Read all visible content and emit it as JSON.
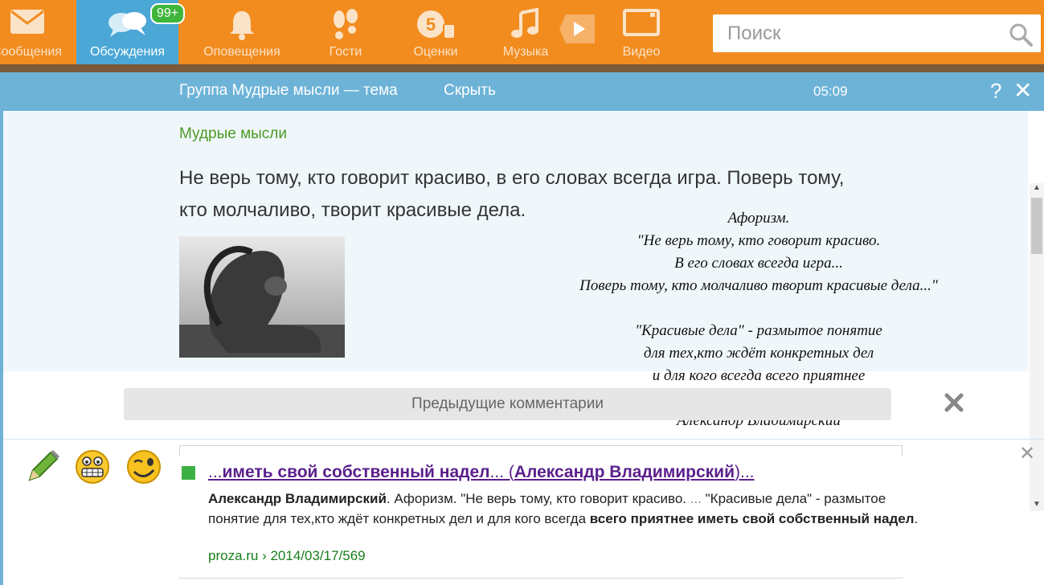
{
  "topnav": {
    "items": [
      {
        "label": "Сообщения"
      },
      {
        "label": "Обсуждения",
        "badge": "99+"
      },
      {
        "label": "Оповещения"
      },
      {
        "label": "Гости"
      },
      {
        "label": "Оценки"
      },
      {
        "label": "Музыка"
      },
      {
        "label": "Видео"
      }
    ],
    "search_placeholder": "Поиск"
  },
  "panel": {
    "title": "Группа Мудрые мысли — тема",
    "hide_label": "Скрыть",
    "time": "05:09",
    "help_glyph": "?",
    "close_glyph": "✕"
  },
  "post": {
    "group": "Мудрые мысли",
    "text": "Не верь тому, кто говорит красиво, в его словах всегда игра. Поверь тому, кто молчаливо, творит красивые дела.",
    "aphorism": "Афоризм.\n\"Не верь тому, кто говорит красиво.\nВ его словах всегда игра...\nПоверь тому, кто молчаливо творит красивые дела...\"\n\n\"Красивые дела\" - размытое понятие\nдля тех,кто ждёт конкретных дел\nи для кого всегда всего приятнее\nиметь свой собственный надел.\nАлександр Владимирский"
  },
  "comments": {
    "prev_label": "Предыдущие комментарии"
  },
  "composer": {
    "close_glyph": "✕"
  },
  "snippet": {
    "title_pre": "...",
    "title_bold": "иметь свой собственный надел",
    "title_mid": "... (",
    "title_author": "Александр Владимирский",
    "title_post": ")...",
    "body_author": "Александр Владимирский",
    "body_1": ". Афоризм. \"Не верь тому, кто говорит красиво. ",
    "body_dots": "...",
    "body_2": " \"Красивые дела\" - размытое понятие для тех,кто ждёт конкретных дел и для кого всегда ",
    "body_bold": "всего приятнее иметь свой собственный надел",
    "body_end": ".",
    "url": "proza.ru › 2014/03/17/569"
  },
  "colors": {
    "nav_orange": "#f28c1f",
    "nav_active": "#4aa7d6",
    "badge_green": "#3fb53a",
    "header_blue": "#6db3d8",
    "group_green": "#4c9a23",
    "link_purple": "#5a1f8c",
    "url_green": "#1a7f1a"
  }
}
